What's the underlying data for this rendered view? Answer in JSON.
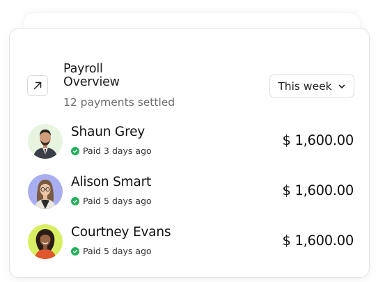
{
  "widget": {
    "title": "Payroll Overview",
    "subtitle": "12 payments settled",
    "open_icon": "arrow-up-right-icon",
    "period_select": {
      "selected": "This week",
      "icon": "chevron-down-icon"
    }
  },
  "payments": [
    {
      "name": "Shaun Grey",
      "status": "Paid 3 days ago",
      "amount": "$ 1,600.00",
      "avatar_bg": "#e6f4e0",
      "status_color": "#22b15a"
    },
    {
      "name": "Alison Smart",
      "status": "Paid 5 days ago",
      "amount": "$ 1,600.00",
      "avatar_bg": "#a9aef0",
      "status_color": "#22b15a"
    },
    {
      "name": "Courtney Evans",
      "status": "Paid 5 days ago",
      "amount": "$ 1,600.00",
      "avatar_bg": "#d8ef63",
      "status_color": "#22b15a"
    }
  ]
}
